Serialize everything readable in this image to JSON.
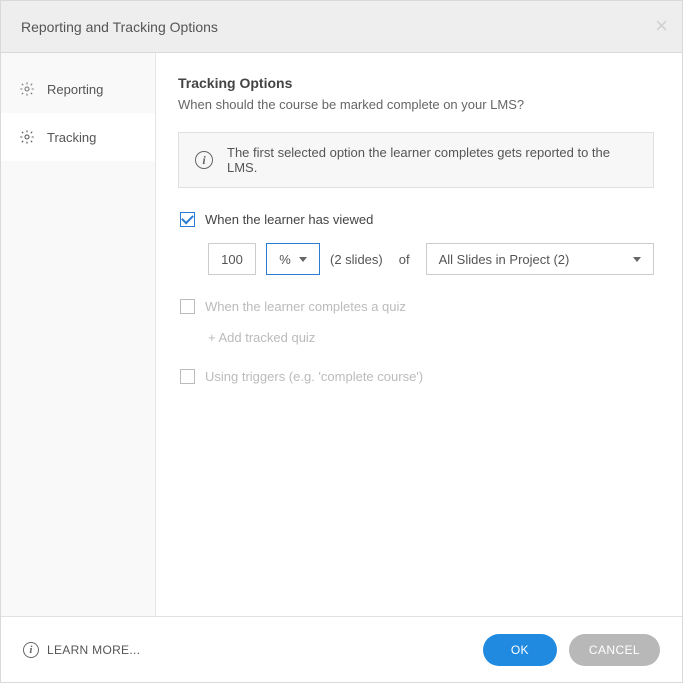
{
  "dialog": {
    "title": "Reporting and Tracking Options"
  },
  "sidebar": {
    "items": [
      {
        "label": "Reporting"
      },
      {
        "label": "Tracking"
      }
    ]
  },
  "tracking": {
    "heading": "Tracking Options",
    "subhead": "When should the course be marked complete on your LMS?",
    "info": "The first selected option the learner completes gets reported to the LMS.",
    "optViewed": {
      "label": "When the learner has viewed",
      "numValue": "100",
      "pctLabel": "%",
      "countLabel": "(2 slides)",
      "ofLabel": "of",
      "scopeLabel": "All Slides in Project (2)"
    },
    "optQuiz": {
      "label": "When the learner completes a quiz",
      "addLabel": "+ Add tracked quiz"
    },
    "optTriggers": {
      "label": "Using triggers (e.g. 'complete course')"
    }
  },
  "footer": {
    "learn": "LEARN MORE...",
    "ok": "OK",
    "cancel": "CANCEL"
  }
}
